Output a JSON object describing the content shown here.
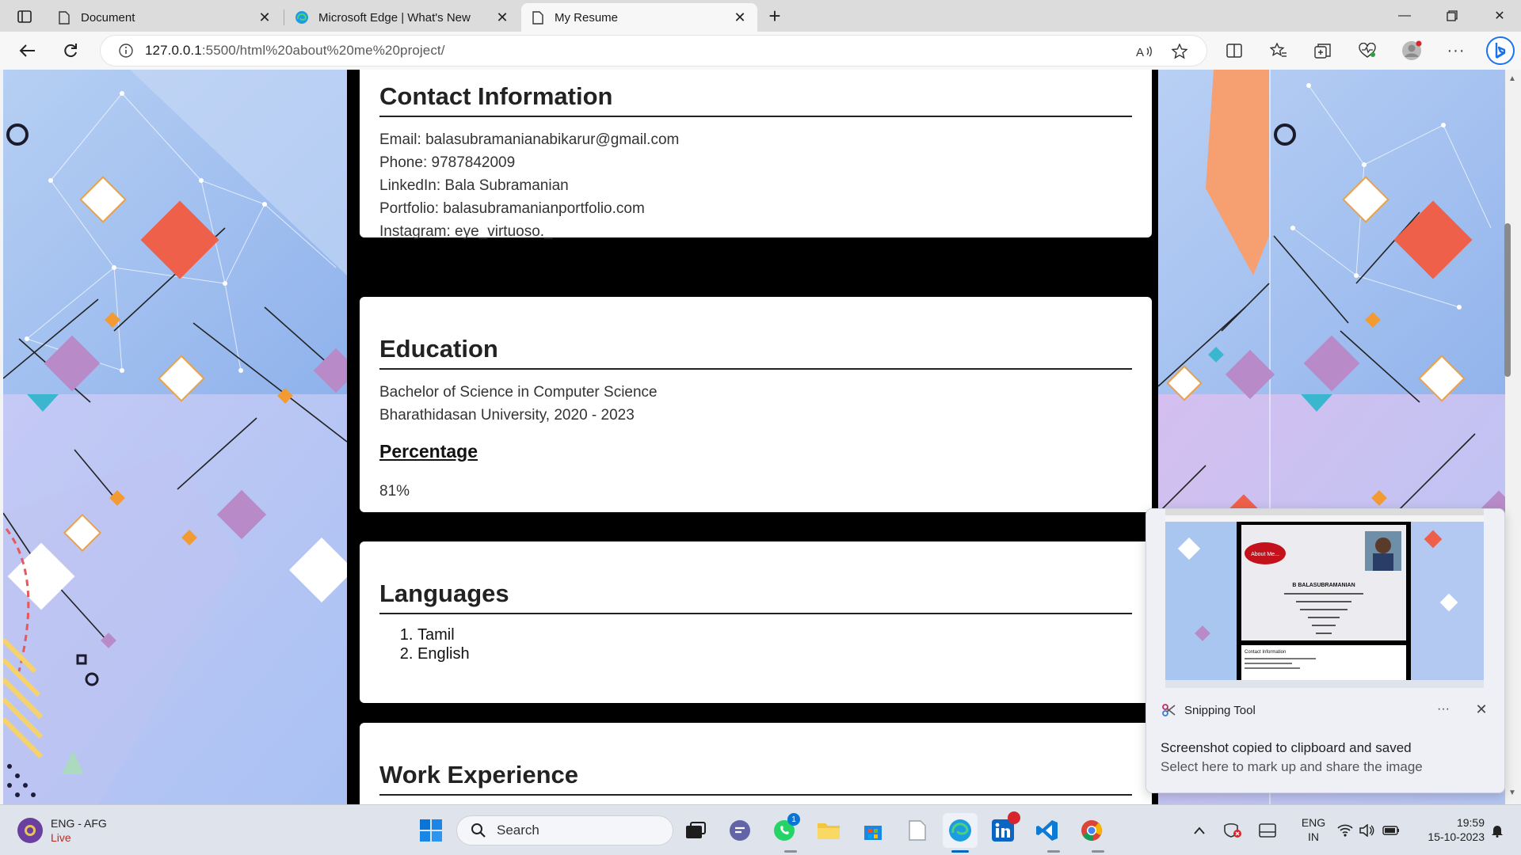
{
  "browser": {
    "tabs": [
      {
        "title": "Document",
        "icon": "document-icon",
        "active": false
      },
      {
        "title": "Microsoft Edge | What's New",
        "icon": "edge-icon",
        "active": false
      },
      {
        "title": "My Resume",
        "icon": "document-icon",
        "active": true
      }
    ],
    "url_host": "127.0.0.1",
    "url_path": ":5500/html%20about%20me%20project/"
  },
  "resume": {
    "contact": {
      "heading": "Contact Information",
      "lines": [
        "Email: balasubramanianabikarur@gmail.com",
        "Phone: 9787842009",
        "LinkedIn: Bala Subramanian",
        "Portfolio: balasubramanianportfolio.com",
        "Instagram: eye_virtuoso._"
      ]
    },
    "education": {
      "heading": "Education",
      "degree": "Bachelor of Science in Computer Science",
      "university": "Bharathidasan University, 2020 - 2023",
      "percentage_heading": "Percentage",
      "percentage_value": "81%"
    },
    "languages": {
      "heading": "Languages",
      "items": [
        "Tamil",
        "English"
      ]
    },
    "work": {
      "heading": "Work Experience"
    }
  },
  "toast": {
    "app_name": "Snipping Tool",
    "title": "Screenshot copied to clipboard and saved",
    "body": "Select here to mark up and share the image",
    "thumb_badge": "About Me...",
    "thumb_name": "B BALASUBRAMANIAN",
    "thumb_contact": "Contact Information"
  },
  "taskbar": {
    "weather_title": "ENG - AFG",
    "weather_sub": "Live",
    "search_label": "Search",
    "whatsapp_badge": "1",
    "lang_top": "ENG",
    "lang_bottom": "IN",
    "time": "19:59",
    "date": "15-10-2023"
  },
  "colors": {
    "accent": "#0067c0",
    "background_pattern": "#a9c8f2",
    "diamond_red": "#f0604a",
    "diamond_orange": "#f5a03a",
    "diamond_purple": "#b98ac8"
  }
}
